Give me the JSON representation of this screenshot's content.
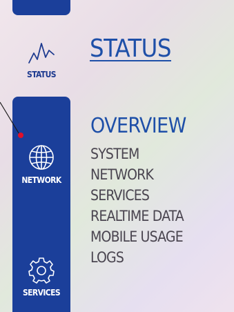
{
  "nav": {
    "items": [
      {
        "label": "STATUS",
        "icon": "pulse-icon"
      },
      {
        "label": "NETWORK",
        "icon": "globe-icon"
      },
      {
        "label": "SERVICES",
        "icon": "gear-icon"
      }
    ]
  },
  "main": {
    "title": "STATUS",
    "menu": [
      "OVERVIEW",
      "SYSTEM",
      "NETWORK",
      "SERVICES",
      "REALTIME DATA",
      "MOBILE USAGE",
      "LOGS"
    ]
  },
  "colors": {
    "accent": "#1e4fa8",
    "nav_bg": "#1b3f9a",
    "text": "#4a4550",
    "pointer_dot": "#e0102a"
  }
}
